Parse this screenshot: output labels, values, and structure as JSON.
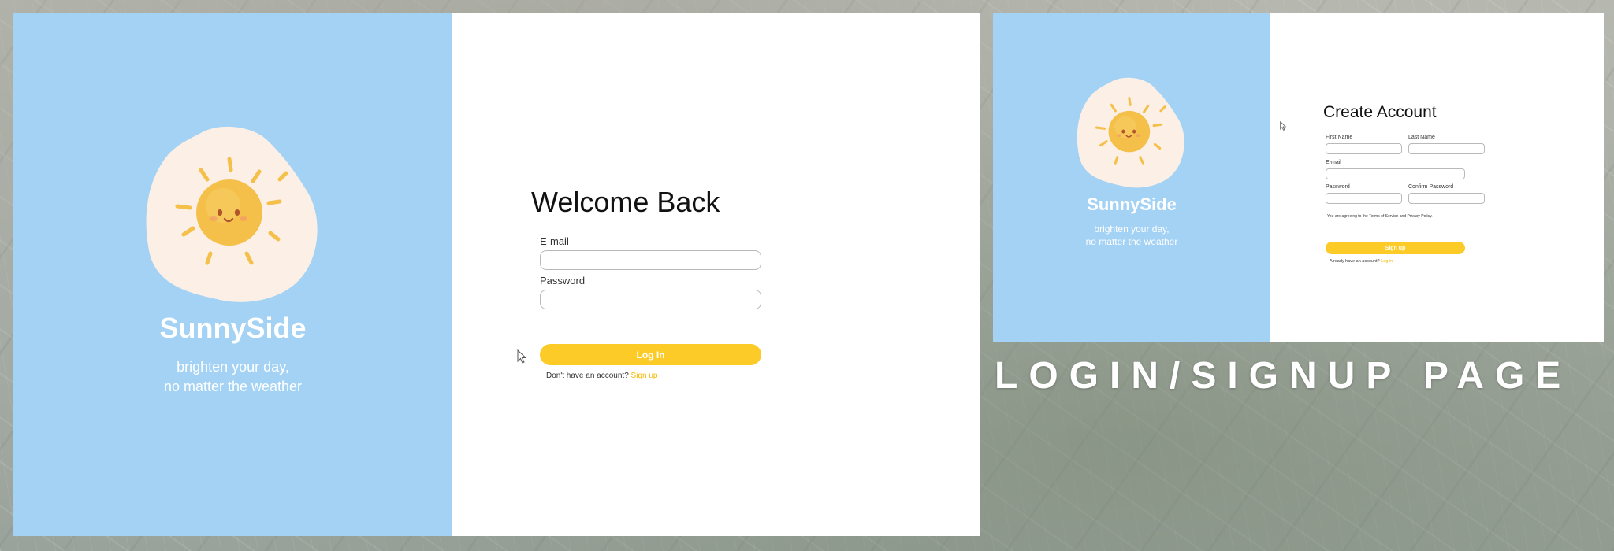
{
  "brand": {
    "name": "SunnySide",
    "tagline_line1": "brighten your day,",
    "tagline_line2": "no matter the weather"
  },
  "login": {
    "title": "Welcome Back",
    "email_label": "E-mail",
    "password_label": "Password",
    "button_label": "Log In",
    "prompt_text": "Don't have an account?",
    "prompt_link": "Sign up"
  },
  "signup": {
    "title": "Create Account",
    "first_name_label": "First Name",
    "last_name_label": "Last Name",
    "email_label": "E-mail",
    "password_label": "Password",
    "confirm_password_label": "Confirm Password",
    "terms_text": "You are agreeing to the Terms of Service and Privacy Policy.",
    "button_label": "Sign up",
    "prompt_text": "Already have an account?",
    "prompt_link": "Log in"
  },
  "caption": "LOGIN/SIGNUP PAGE",
  "colors": {
    "panel_blue": "#a3d2f4",
    "button_yellow": "#fccb27",
    "link_yellow": "#f5b800"
  }
}
